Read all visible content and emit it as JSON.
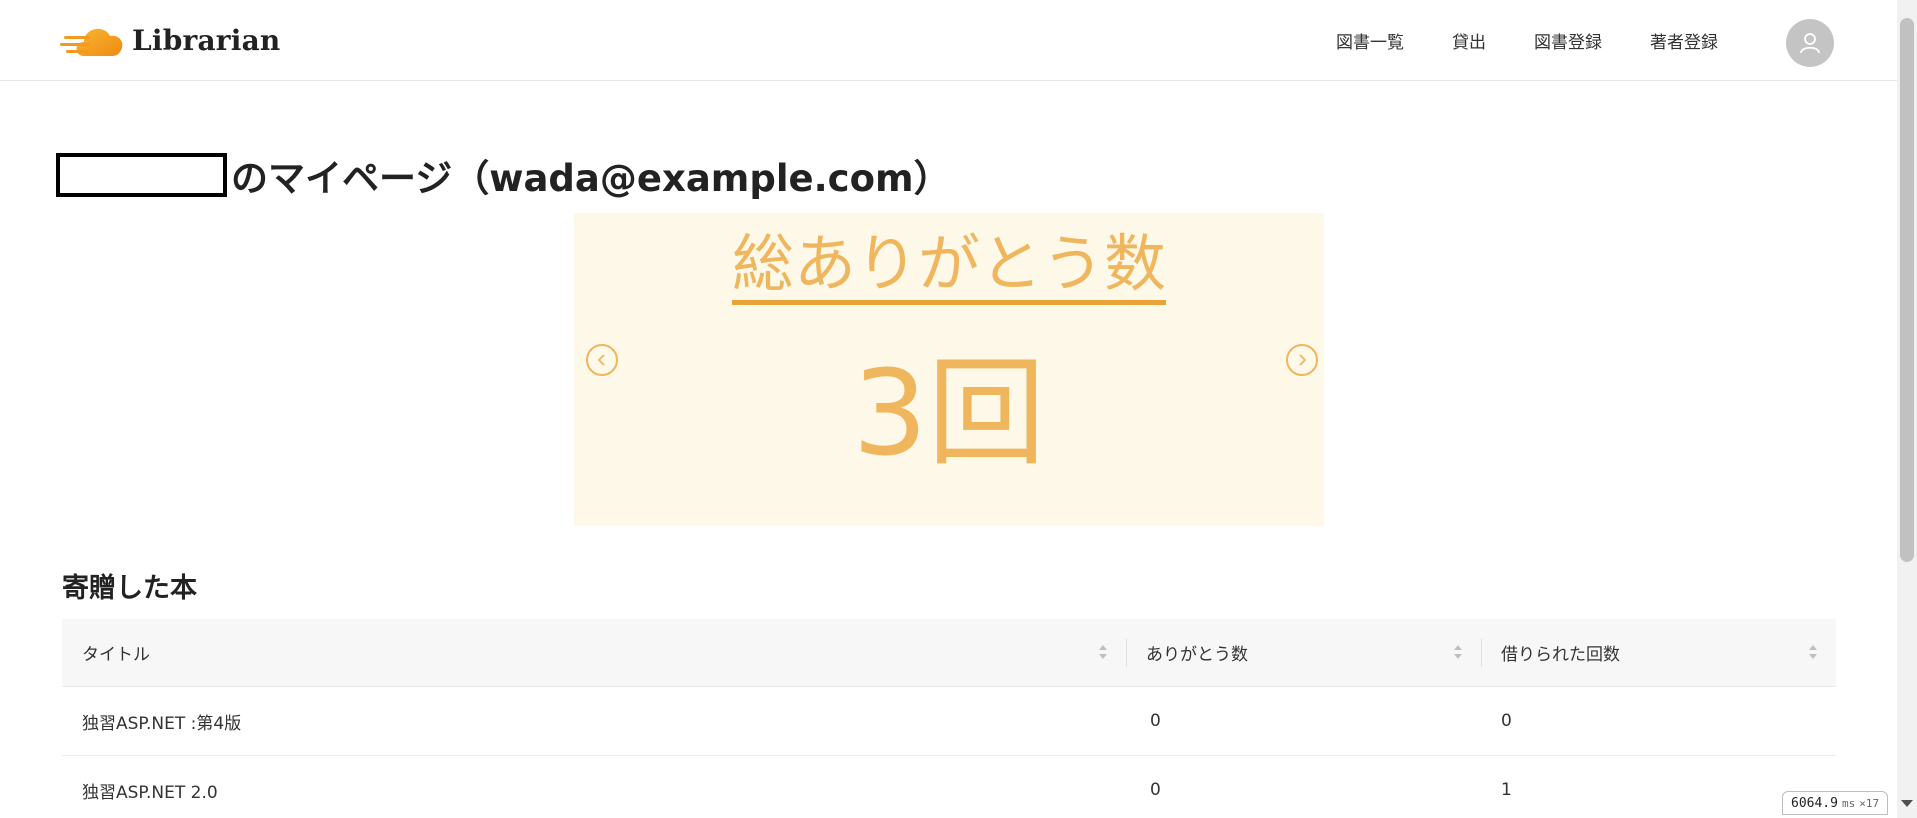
{
  "app": {
    "name": "Librarian"
  },
  "nav": {
    "items": [
      "図書一覧",
      "貸出",
      "図書登録",
      "著者登録"
    ]
  },
  "page": {
    "title_suffix": "のマイページ（wada@example.com）"
  },
  "carousel": {
    "heading": "総ありがとう数",
    "value": "3回",
    "prev_icon": "chevron-left-icon",
    "next_icon": "chevron-right-icon",
    "accent_color": "#efb65e",
    "background_color": "#fdf8e8"
  },
  "donated_books": {
    "section_title": "寄贈した本",
    "columns": [
      "タイトル",
      "ありがとう数",
      "借りられた回数"
    ],
    "rows": [
      {
        "title": "独習ASP.NET :第4版",
        "thanks": "0",
        "borrowed": "0"
      },
      {
        "title": "独習ASP.NET 2.0",
        "thanks": "0",
        "borrowed": "1"
      }
    ]
  },
  "timing": {
    "value": "6064.9",
    "unit": "ms",
    "count": "×17"
  }
}
